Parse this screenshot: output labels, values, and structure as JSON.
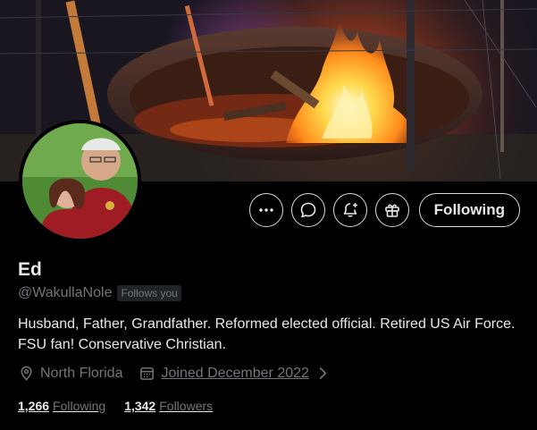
{
  "profile": {
    "name": "Ed",
    "handle": "@WakullaNole",
    "follows_you": "Follows you",
    "bio": "Husband, Father, Grandfather. Reformed elected official. Retired US Air Force. FSU fan! Conservative Christian.",
    "location": "North Florida",
    "joined": "Joined December 2022"
  },
  "stats": {
    "following_count": "1,266",
    "following_label": "Following",
    "followers_count": "1,342",
    "followers_label": "Followers"
  },
  "actions": {
    "more_icon": "more-icon",
    "message_icon": "message-icon",
    "notify_icon": "bell-plus-icon",
    "subscribe_icon": "gift-icon",
    "follow_label": "Following"
  },
  "icons": {
    "location": "location-pin-icon",
    "calendar": "calendar-icon",
    "chevron": "chevron-right-icon"
  },
  "colors": {
    "background": "#000000",
    "text_primary": "#e7e9ea",
    "text_secondary": "#71767b",
    "badge_bg": "#202327",
    "button_border": "#d9d9d9"
  }
}
